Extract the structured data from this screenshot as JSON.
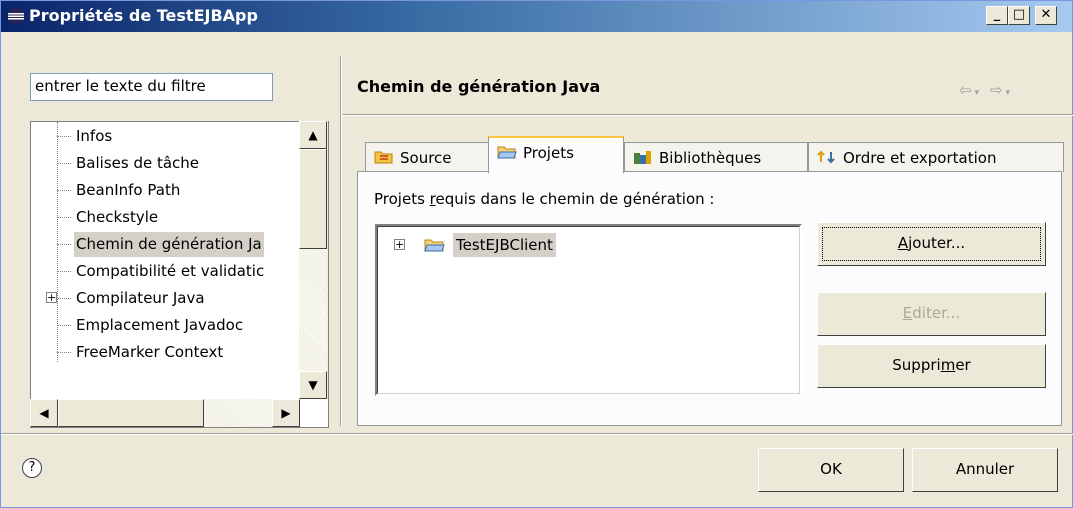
{
  "window": {
    "title": "Propriétés de TestEJBApp",
    "controls": {
      "minimize": "_",
      "maximize": "□",
      "close": "✕"
    }
  },
  "sidebar": {
    "filter_placeholder": "entrer le texte du filtre",
    "items": [
      {
        "label": "Infos"
      },
      {
        "label": "Balises de tâche"
      },
      {
        "label": "BeanInfo Path"
      },
      {
        "label": "Checkstyle"
      },
      {
        "label": "Chemin de génération Ja",
        "selected": true
      },
      {
        "label": "Compatibilité et validatic"
      },
      {
        "label": "Compilateur Java",
        "expandable": true
      },
      {
        "label": "Emplacement Javadoc"
      },
      {
        "label": "FreeMarker Context"
      }
    ]
  },
  "main": {
    "title": "Chemin de génération Java",
    "nav": {
      "back": "⇦",
      "forward": "⇨"
    },
    "tabs": [
      {
        "label": "Source",
        "icon": "source-folder-icon"
      },
      {
        "label": "Projets",
        "icon": "project-folder-icon",
        "active": true
      },
      {
        "label": "Bibliothèques",
        "icon": "library-icon"
      },
      {
        "label": "Ordre et exportation",
        "icon": "order-export-icon"
      }
    ],
    "required_label_pre": "Projets ",
    "required_label_mnemonic": "r",
    "required_label_post": "equis dans le chemin de génération :",
    "projects": [
      {
        "name": "TestEJBClient"
      }
    ],
    "buttons": {
      "add_mnemonic": "A",
      "add_rest": "jouter...",
      "edit_mnemonic": "E",
      "edit_rest": "diter...",
      "remove_pre": "Suppri",
      "remove_mnemonic": "m",
      "remove_post": "er"
    }
  },
  "footer": {
    "help": "?",
    "ok": "OK",
    "cancel": "Annuler"
  }
}
